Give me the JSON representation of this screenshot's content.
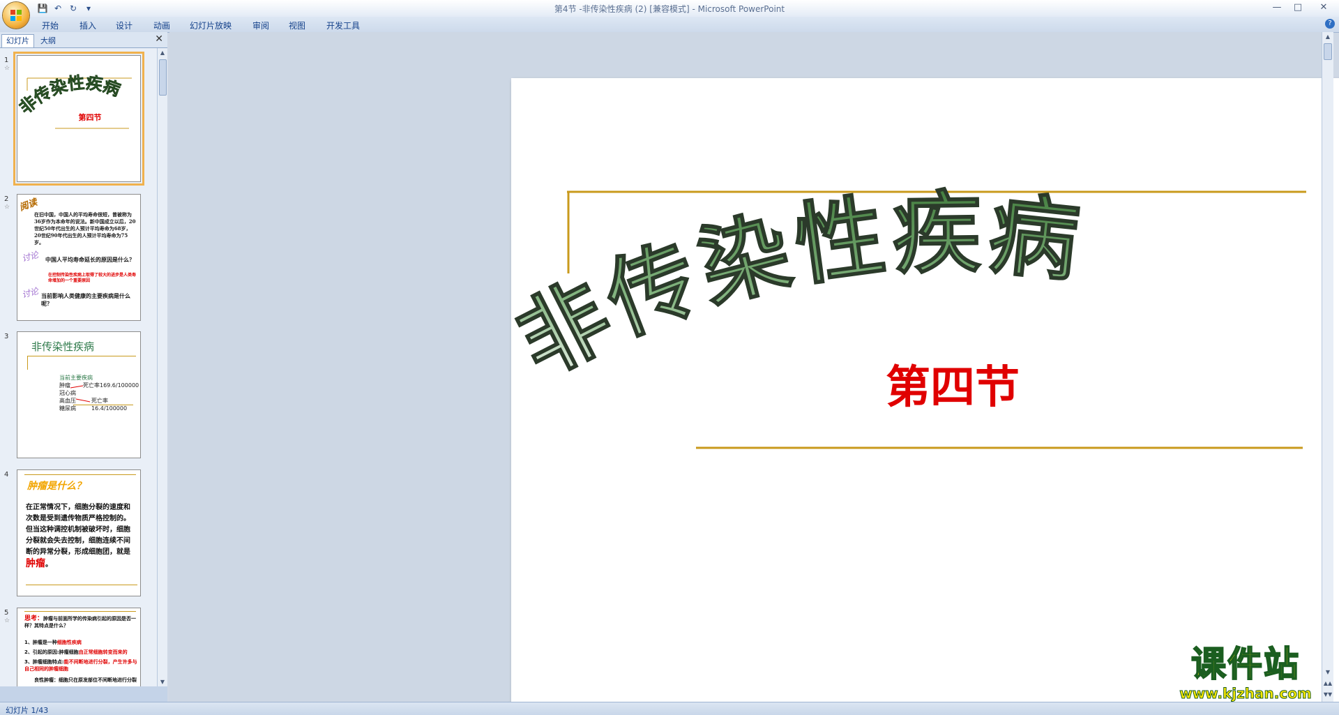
{
  "window": {
    "title": "第4节 -非传染性疾病 (2) [兼容模式] - Microsoft PowerPoint",
    "controls": [
      "—",
      "□",
      "✕"
    ]
  },
  "qat": {
    "save": "💾",
    "undo": "↶",
    "redo": "↻",
    "more": "▾"
  },
  "ribbon": {
    "tabs": [
      "开始",
      "插入",
      "设计",
      "动画",
      "幻灯片放映",
      "审阅",
      "视图",
      "开发工具"
    ],
    "help": "?"
  },
  "pane": {
    "tabs": [
      "幻灯片",
      "大纲"
    ],
    "close": "✕"
  },
  "slides": [
    {
      "num": "1",
      "title": "非传染性疾病",
      "subtitle": "第四节"
    },
    {
      "num": "2",
      "badge1": "阅读",
      "text1": "在旧中国，中国人的平均寿命很短，曾被称为36岁作为本命年的说法。新中国成立以后，20世纪50年代出生的人预计平均寿命为68岁，20世纪90年代出生的人预计平均寿命为75岁。",
      "badge2": "讨论",
      "q1": "中国人平均寿命延长的原因是什么？",
      "a1": "在控制传染性疾病上取得了较大的进步是人类寿命增加的一个重要原因",
      "badge3": "讨论",
      "q2": "当前影响人类健康的主要疾病是什么呢？"
    },
    {
      "num": "3",
      "title": "非传染性疾病",
      "list_title": "当前主要疾病",
      "items": [
        "肿瘤",
        "冠心病",
        "高血压",
        "糖尿病"
      ],
      "stat1": "死亡率169.6/100000",
      "stat2": "死亡率16.4/100000"
    },
    {
      "num": "4",
      "title": "肿瘤是什么？",
      "body": "在正常情况下，细胞分裂的速度和次数是受到遗传物质严格控制的。但当这种调控机制被破坏时，细胞分裂就会失去控制，细胞连续不间断的异常分裂，形成细胞团，就是",
      "highlight": "肿瘤",
      "end": "。"
    },
    {
      "num": "5",
      "think_label": "思考：",
      "think": "肿瘤与前面所学的传染病引起的原因是否一样？其特点是什么？",
      "p1a": "1、肿瘤是一种",
      "p1b": "细胞性疾病",
      "p2a": "2、引起的原因:肿瘤细胞",
      "p2b": "由正常细胞转变而来的",
      "p3a": "3、肿瘤细胞特点:",
      "p3b": "能不间断地进行分裂，产生许多与自己相同的肿瘤细胞",
      "p4": "良性肿瘤：细胞只在原发部位不间断地进行分裂"
    }
  ],
  "main_slide": {
    "title": "非传染性疾病",
    "subtitle": "第四节"
  },
  "status": {
    "slide_info": "幻灯片 1/43"
  },
  "watermark": {
    "title": "课件站",
    "url": "www.kjzhan.com"
  },
  "colors": {
    "accent_gold": "#c99a1c",
    "title_green": "#4a7d45",
    "subtitle_red": "#e00000"
  }
}
